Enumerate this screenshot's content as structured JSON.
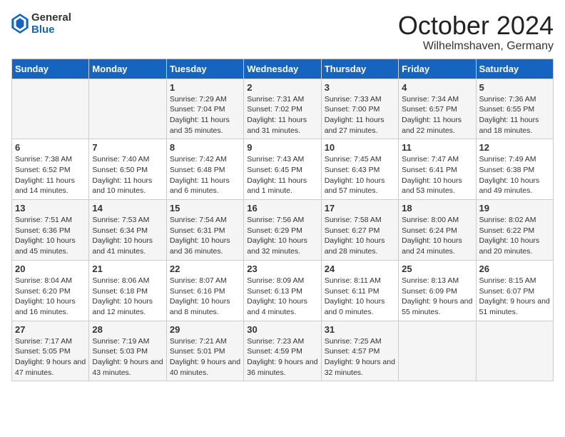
{
  "header": {
    "logo_general": "General",
    "logo_blue": "Blue",
    "month_title": "October 2024",
    "location": "Wilhelmshaven, Germany"
  },
  "days_of_week": [
    "Sunday",
    "Monday",
    "Tuesday",
    "Wednesday",
    "Thursday",
    "Friday",
    "Saturday"
  ],
  "weeks": [
    [
      {
        "day": "",
        "sunrise": "",
        "sunset": "",
        "daylight": ""
      },
      {
        "day": "",
        "sunrise": "",
        "sunset": "",
        "daylight": ""
      },
      {
        "day": "1",
        "sunrise": "Sunrise: 7:29 AM",
        "sunset": "Sunset: 7:04 PM",
        "daylight": "Daylight: 11 hours and 35 minutes."
      },
      {
        "day": "2",
        "sunrise": "Sunrise: 7:31 AM",
        "sunset": "Sunset: 7:02 PM",
        "daylight": "Daylight: 11 hours and 31 minutes."
      },
      {
        "day": "3",
        "sunrise": "Sunrise: 7:33 AM",
        "sunset": "Sunset: 7:00 PM",
        "daylight": "Daylight: 11 hours and 27 minutes."
      },
      {
        "day": "4",
        "sunrise": "Sunrise: 7:34 AM",
        "sunset": "Sunset: 6:57 PM",
        "daylight": "Daylight: 11 hours and 22 minutes."
      },
      {
        "day": "5",
        "sunrise": "Sunrise: 7:36 AM",
        "sunset": "Sunset: 6:55 PM",
        "daylight": "Daylight: 11 hours and 18 minutes."
      }
    ],
    [
      {
        "day": "6",
        "sunrise": "Sunrise: 7:38 AM",
        "sunset": "Sunset: 6:52 PM",
        "daylight": "Daylight: 11 hours and 14 minutes."
      },
      {
        "day": "7",
        "sunrise": "Sunrise: 7:40 AM",
        "sunset": "Sunset: 6:50 PM",
        "daylight": "Daylight: 11 hours and 10 minutes."
      },
      {
        "day": "8",
        "sunrise": "Sunrise: 7:42 AM",
        "sunset": "Sunset: 6:48 PM",
        "daylight": "Daylight: 11 hours and 6 minutes."
      },
      {
        "day": "9",
        "sunrise": "Sunrise: 7:43 AM",
        "sunset": "Sunset: 6:45 PM",
        "daylight": "Daylight: 11 hours and 1 minute."
      },
      {
        "day": "10",
        "sunrise": "Sunrise: 7:45 AM",
        "sunset": "Sunset: 6:43 PM",
        "daylight": "Daylight: 10 hours and 57 minutes."
      },
      {
        "day": "11",
        "sunrise": "Sunrise: 7:47 AM",
        "sunset": "Sunset: 6:41 PM",
        "daylight": "Daylight: 10 hours and 53 minutes."
      },
      {
        "day": "12",
        "sunrise": "Sunrise: 7:49 AM",
        "sunset": "Sunset: 6:38 PM",
        "daylight": "Daylight: 10 hours and 49 minutes."
      }
    ],
    [
      {
        "day": "13",
        "sunrise": "Sunrise: 7:51 AM",
        "sunset": "Sunset: 6:36 PM",
        "daylight": "Daylight: 10 hours and 45 minutes."
      },
      {
        "day": "14",
        "sunrise": "Sunrise: 7:53 AM",
        "sunset": "Sunset: 6:34 PM",
        "daylight": "Daylight: 10 hours and 41 minutes."
      },
      {
        "day": "15",
        "sunrise": "Sunrise: 7:54 AM",
        "sunset": "Sunset: 6:31 PM",
        "daylight": "Daylight: 10 hours and 36 minutes."
      },
      {
        "day": "16",
        "sunrise": "Sunrise: 7:56 AM",
        "sunset": "Sunset: 6:29 PM",
        "daylight": "Daylight: 10 hours and 32 minutes."
      },
      {
        "day": "17",
        "sunrise": "Sunrise: 7:58 AM",
        "sunset": "Sunset: 6:27 PM",
        "daylight": "Daylight: 10 hours and 28 minutes."
      },
      {
        "day": "18",
        "sunrise": "Sunrise: 8:00 AM",
        "sunset": "Sunset: 6:24 PM",
        "daylight": "Daylight: 10 hours and 24 minutes."
      },
      {
        "day": "19",
        "sunrise": "Sunrise: 8:02 AM",
        "sunset": "Sunset: 6:22 PM",
        "daylight": "Daylight: 10 hours and 20 minutes."
      }
    ],
    [
      {
        "day": "20",
        "sunrise": "Sunrise: 8:04 AM",
        "sunset": "Sunset: 6:20 PM",
        "daylight": "Daylight: 10 hours and 16 minutes."
      },
      {
        "day": "21",
        "sunrise": "Sunrise: 8:06 AM",
        "sunset": "Sunset: 6:18 PM",
        "daylight": "Daylight: 10 hours and 12 minutes."
      },
      {
        "day": "22",
        "sunrise": "Sunrise: 8:07 AM",
        "sunset": "Sunset: 6:16 PM",
        "daylight": "Daylight: 10 hours and 8 minutes."
      },
      {
        "day": "23",
        "sunrise": "Sunrise: 8:09 AM",
        "sunset": "Sunset: 6:13 PM",
        "daylight": "Daylight: 10 hours and 4 minutes."
      },
      {
        "day": "24",
        "sunrise": "Sunrise: 8:11 AM",
        "sunset": "Sunset: 6:11 PM",
        "daylight": "Daylight: 10 hours and 0 minutes."
      },
      {
        "day": "25",
        "sunrise": "Sunrise: 8:13 AM",
        "sunset": "Sunset: 6:09 PM",
        "daylight": "Daylight: 9 hours and 55 minutes."
      },
      {
        "day": "26",
        "sunrise": "Sunrise: 8:15 AM",
        "sunset": "Sunset: 6:07 PM",
        "daylight": "Daylight: 9 hours and 51 minutes."
      }
    ],
    [
      {
        "day": "27",
        "sunrise": "Sunrise: 7:17 AM",
        "sunset": "Sunset: 5:05 PM",
        "daylight": "Daylight: 9 hours and 47 minutes."
      },
      {
        "day": "28",
        "sunrise": "Sunrise: 7:19 AM",
        "sunset": "Sunset: 5:03 PM",
        "daylight": "Daylight: 9 hours and 43 minutes."
      },
      {
        "day": "29",
        "sunrise": "Sunrise: 7:21 AM",
        "sunset": "Sunset: 5:01 PM",
        "daylight": "Daylight: 9 hours and 40 minutes."
      },
      {
        "day": "30",
        "sunrise": "Sunrise: 7:23 AM",
        "sunset": "Sunset: 4:59 PM",
        "daylight": "Daylight: 9 hours and 36 minutes."
      },
      {
        "day": "31",
        "sunrise": "Sunrise: 7:25 AM",
        "sunset": "Sunset: 4:57 PM",
        "daylight": "Daylight: 9 hours and 32 minutes."
      },
      {
        "day": "",
        "sunrise": "",
        "sunset": "",
        "daylight": ""
      },
      {
        "day": "",
        "sunrise": "",
        "sunset": "",
        "daylight": ""
      }
    ]
  ]
}
